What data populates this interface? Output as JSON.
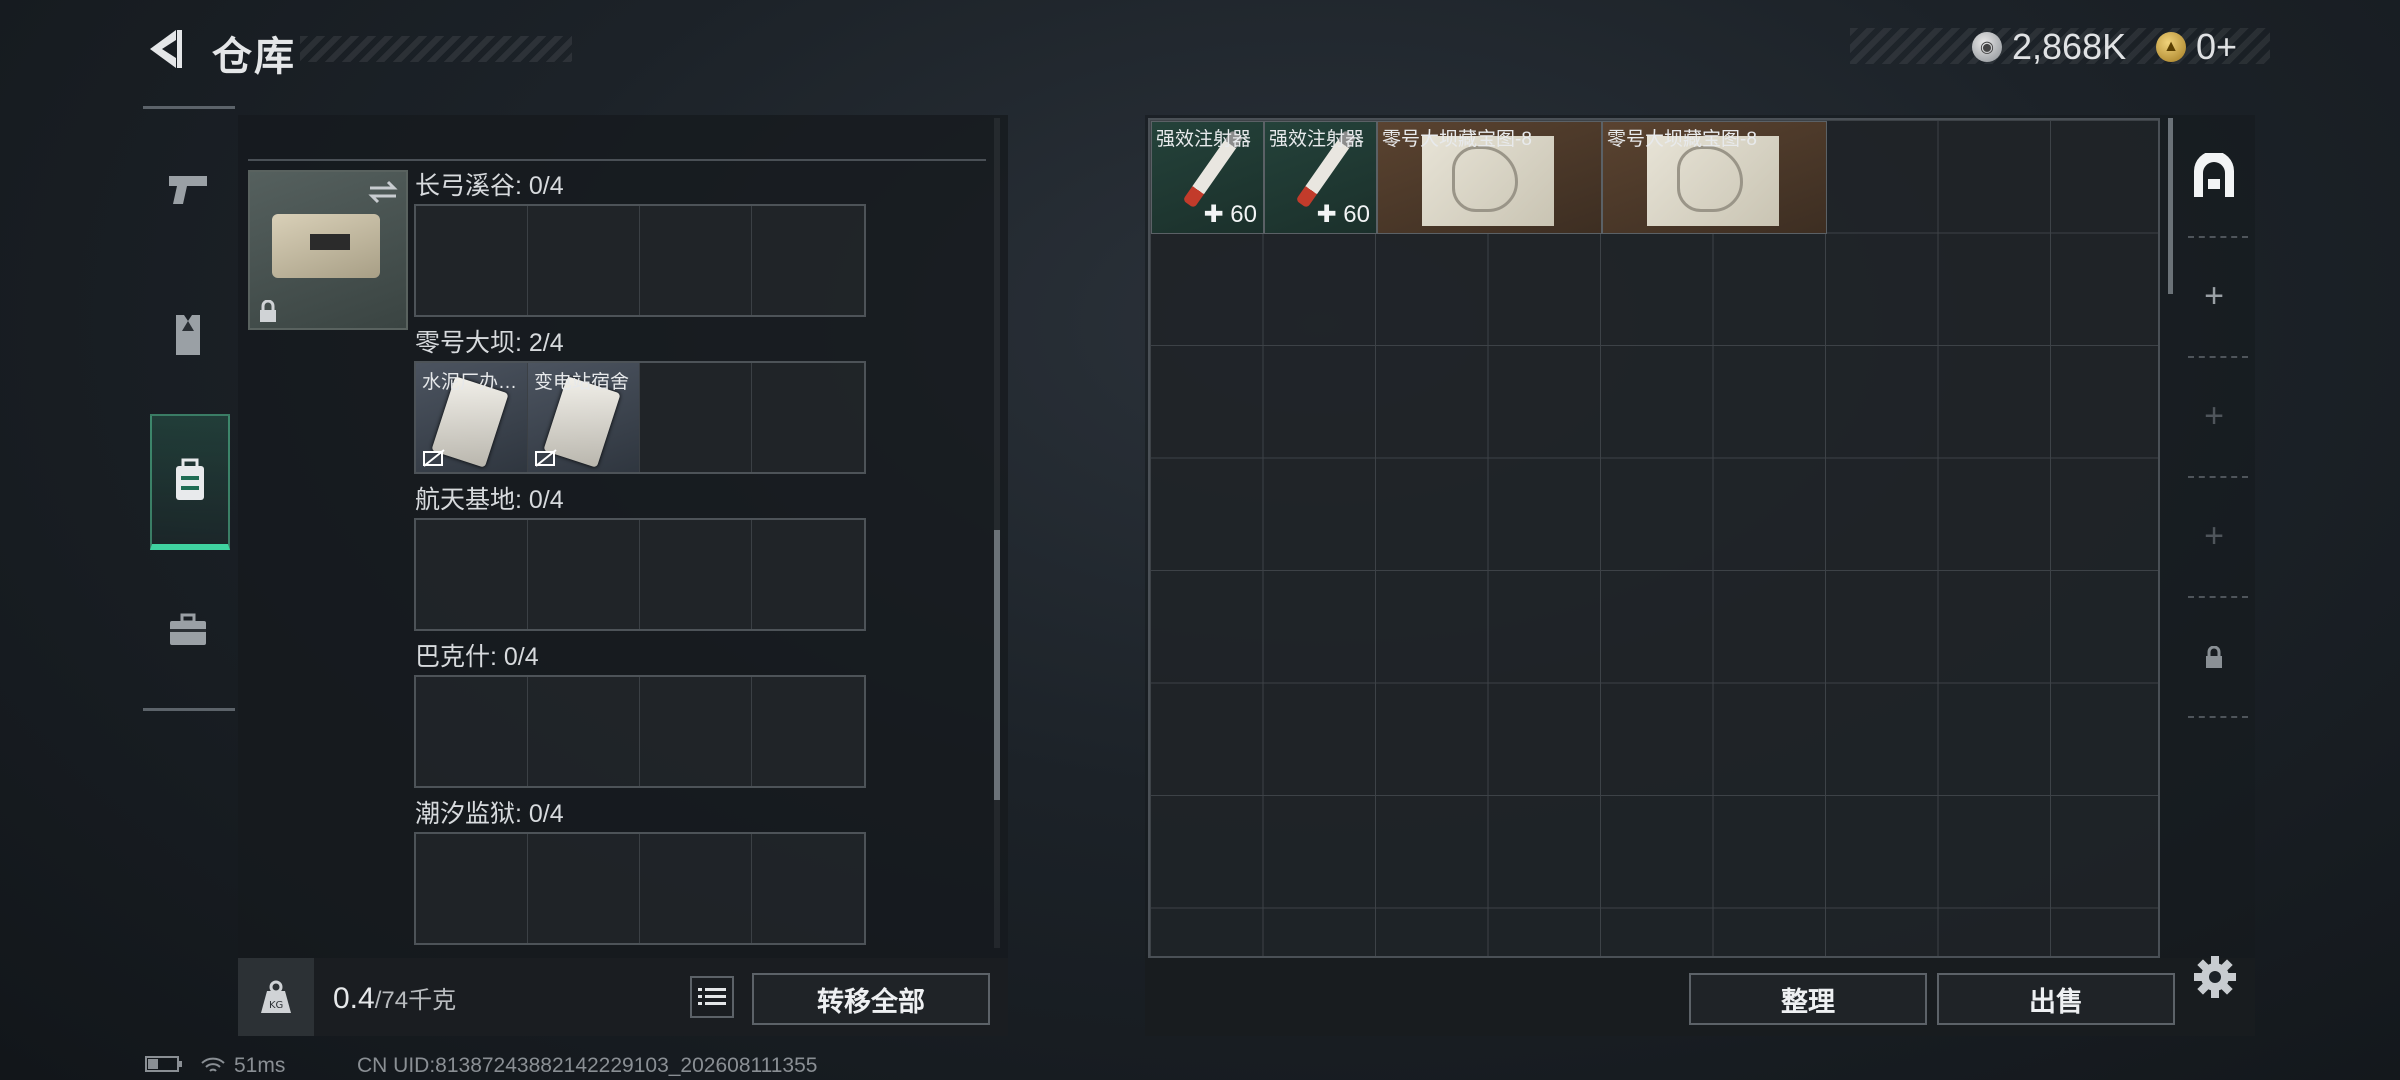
{
  "header": {
    "title": "仓库",
    "back_icon": "back-arrow-icon"
  },
  "currency": {
    "silver_value": "2,868K",
    "gold_value": "0+",
    "silver_icon": "silver-coin-icon",
    "gold_icon": "gold-triangle-coin-icon"
  },
  "nav": {
    "items": [
      {
        "icon": "pistol-icon",
        "active": false
      },
      {
        "icon": "armor-vest-icon",
        "active": false
      },
      {
        "icon": "backpack-icon",
        "active": true
      },
      {
        "icon": "briefcase-icon",
        "active": false
      }
    ]
  },
  "left_panel": {
    "container_icons": {
      "swap": "swap-arrows-icon",
      "lock": "lock-icon"
    },
    "categories": [
      {
        "label": "长弓溪谷: 0/4",
        "cards": []
      },
      {
        "label": "零号大坝: 2/4",
        "cards": [
          {
            "name": "水泥厂办…"
          },
          {
            "name": "变电站宿舍"
          }
        ]
      },
      {
        "label": "航天基地: 0/4",
        "cards": []
      },
      {
        "label": "巴克什: 0/4",
        "cards": []
      },
      {
        "label": "潮汐监狱: 0/4",
        "cards": []
      }
    ],
    "weight_current": "0.4",
    "weight_total": "/74千克",
    "transfer_all": "转移全部"
  },
  "stash": {
    "items": [
      {
        "name": "强效注射器",
        "value": "60",
        "type": "injector"
      },
      {
        "name": "强效注射器",
        "value": "60",
        "type": "injector"
      },
      {
        "name": "零号大坝藏宝图-8",
        "type": "map"
      },
      {
        "name": "零号大坝藏宝图-8",
        "type": "map"
      }
    ],
    "sort_label": "整理",
    "sell_label": "出售"
  },
  "tools": [
    "stash-main-icon",
    "add-stash-icon",
    "add-stash-icon",
    "add-stash-icon",
    "lock-icon"
  ],
  "status": {
    "ping": "51ms",
    "uid": "CN UID:8138724388214222910​3_202608111355"
  },
  "colors": {
    "accent": "#3fd3a0",
    "injector_bg": "#24423a",
    "map_bg": "#5a4330"
  }
}
